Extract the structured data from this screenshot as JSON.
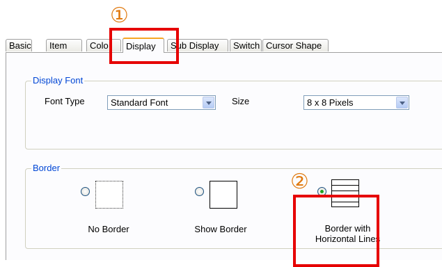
{
  "tabs": [
    {
      "label": "Basic"
    },
    {
      "label": "Item"
    },
    {
      "label": "Colo"
    },
    {
      "label": "Display"
    },
    {
      "label": "Sub Display"
    },
    {
      "label": "Switch"
    },
    {
      "label": "Cursor Shape"
    }
  ],
  "display_font": {
    "legend": "Display Font",
    "font_type_label": "Font Type",
    "font_type_value": "Standard Font",
    "size_label": "Size",
    "size_value": "8 x 8 Pixels"
  },
  "border": {
    "legend": "Border",
    "options": [
      {
        "label": "No Border",
        "checked": false,
        "preview": "dotted-icon"
      },
      {
        "label": "Show Border",
        "checked": false,
        "preview": "solid-border-icon"
      },
      {
        "label_line1": "Border with",
        "label_line2": "Horizontal Lines",
        "checked": true,
        "preview": "horizontal-lines-icon"
      }
    ]
  },
  "annotations": {
    "marker1": "①",
    "marker2": "②",
    "marker_color": "#e07a10",
    "box_color": "#e60000"
  }
}
